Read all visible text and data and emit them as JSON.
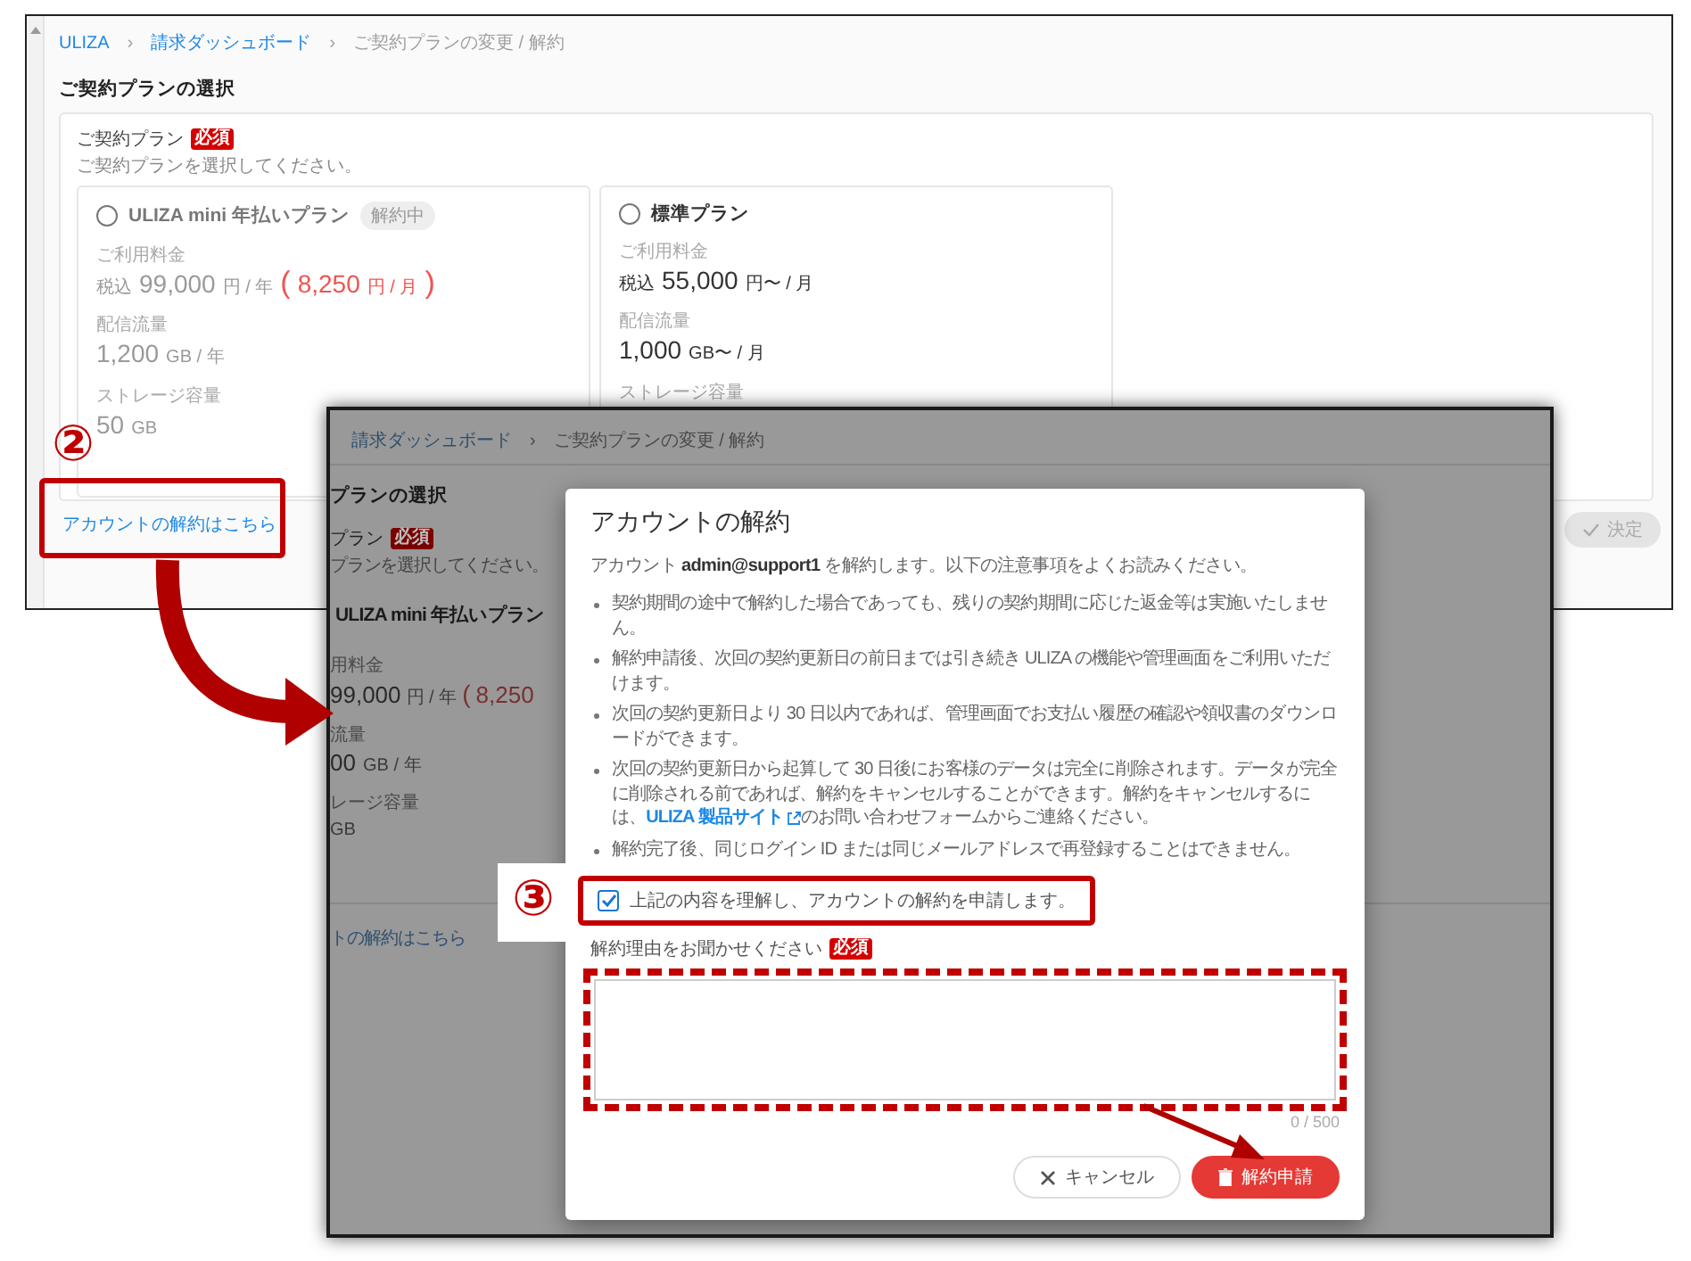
{
  "tutorial_marks": {
    "step_2": "②",
    "step_3": "③"
  },
  "background_screen": {
    "breadcrumb": [
      {
        "kind": "link",
        "label": "ULIZA"
      },
      {
        "kind": "separator",
        "label": "›"
      },
      {
        "kind": "link",
        "label": "請求ダッシュボード"
      },
      {
        "kind": "separator",
        "label": "›"
      },
      {
        "kind": "text",
        "label": "ご契約プランの変更 / 解約"
      }
    ],
    "title": "ご契約プランの選択",
    "plan_field": {
      "label": "ご契約プラン",
      "required_badge": "必須",
      "hint": "ご契約プランを選択してください。"
    },
    "plans": [
      {
        "name": "ULIZA mini 年払いプラン",
        "selected": false,
        "disabled": true,
        "badge": "解約中",
        "price_label": "ご利用料金",
        "price_prefix": "税込",
        "price": "99,000",
        "price_unit": "円 / 年",
        "monthly": {
          "open": "(",
          "price": "8,250",
          "unit": "円 / 月",
          "close": ")"
        },
        "traffic_label": "配信流量",
        "traffic": "1,200",
        "traffic_unit": "GB / 年",
        "storage_label": "ストレージ容量",
        "storage": "50",
        "storage_unit": "GB"
      },
      {
        "name": "標準プラン",
        "selected": false,
        "disabled": false,
        "price_label": "ご利用料金",
        "price_prefix": "税込",
        "price": "55,000",
        "price_unit": "円〜 / 月",
        "traffic_label": "配信流量",
        "traffic": "1,000",
        "traffic_unit": "GB〜 / 月",
        "storage_label": "ストレージ容量"
      }
    ],
    "cancel_link": "アカウントの解約はこちら",
    "submit_button": {
      "label": "決定",
      "disabled": true
    }
  },
  "foreground_screen": {
    "breadcrumb": [
      {
        "kind": "link",
        "label": "請求ダッシュボード"
      },
      {
        "kind": "separator",
        "label": "›"
      },
      {
        "kind": "text",
        "label": "ご契約プランの変更 / 解約"
      }
    ],
    "title": "プランの選択",
    "plan_field": {
      "label": "プラン",
      "required_badge": "必須",
      "hint": "プランを選択してください。"
    },
    "plan": {
      "name": "ULIZA mini 年払いプラン",
      "price_label": "用料金",
      "price": "99,000",
      "price_unit": "円 / 年",
      "monthly_open": "(",
      "monthly_price": "8,250",
      "traffic_label": "流量",
      "traffic": "00",
      "traffic_unit": "GB / 年",
      "storage_label": "レージ容量",
      "storage_unit": "GB"
    },
    "cancel_link": "トの解約はこちら",
    "dialog": {
      "title": "アカウントの解約",
      "intro": "アカウント **admin@support1** を解約します。以下の注意事項をよくお読みください。",
      "notes": [
        {
          "text": "契約期間の途中で解約した場合であっても、残りの契約期間に応じた返金等は実施いたしません。"
        },
        {
          "text": "解約申請後、次回の契約更新日の前日までは引き続き ULIZA の機能や管理画面をご利用いただけます。"
        },
        {
          "text": "次回の契約更新日より 30 日以内であれば、管理画面でお支払い履歴の確認や領収書のダウンロードができます。"
        },
        {
          "text": "次回の契約更新日から起算して 30 日後にお客様のデータは完全に削除されます。データが完全に削除される前であれば、解約をキャンセルすることができます。解約をキャンセルするには、",
          "link": "ULIZA 製品サイト",
          "text_after": "のお問い合わせフォームからご連絡ください。"
        },
        {
          "text": "解約完了後、同じログイン ID または同じメールアドレスで再登録することはできません。"
        }
      ],
      "confirm": {
        "label": "上記の内容を理解し、アカウントの解約を申請します。",
        "checked": true
      },
      "reason": {
        "label": "解約理由をお聞かせください",
        "required_badge": "必須",
        "counter": "0 / 500"
      },
      "buttons": [
        {
          "kind": "cancel",
          "label": "キャンセル"
        },
        {
          "kind": "danger",
          "label": "解約申請"
        }
      ]
    }
  }
}
